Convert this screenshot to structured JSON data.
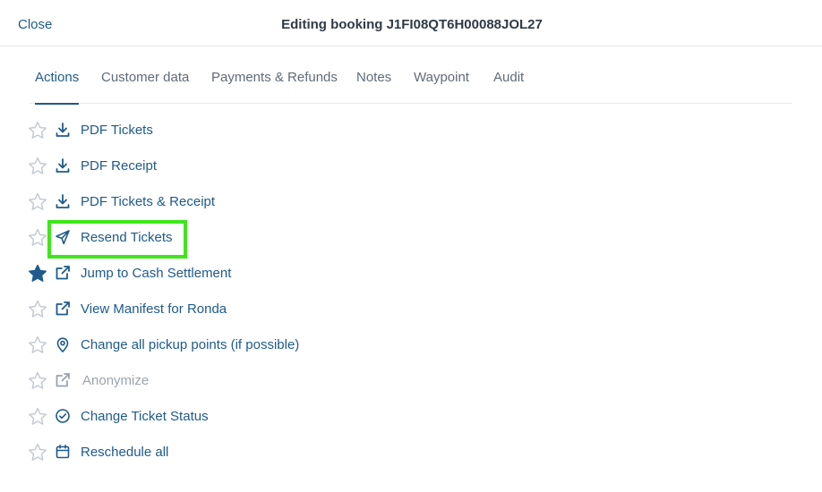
{
  "header": {
    "close_label": "Close",
    "title": "Editing booking J1FI08QT6H00088JOL27"
  },
  "tabs": [
    {
      "label": "Actions",
      "active": true
    },
    {
      "label": "Customer data",
      "active": false
    },
    {
      "label": "Payments & Refunds",
      "active": false
    },
    {
      "label": "Notes",
      "active": false
    },
    {
      "label": "Waypoint",
      "active": false
    },
    {
      "label": "Audit",
      "active": false
    }
  ],
  "actions": [
    {
      "label": "PDF Tickets",
      "icon": "download-icon",
      "starred": false,
      "enabled": true
    },
    {
      "label": "PDF Receipt",
      "icon": "download-icon",
      "starred": false,
      "enabled": true
    },
    {
      "label": "PDF Tickets & Receipt",
      "icon": "download-icon",
      "starred": false,
      "enabled": true
    },
    {
      "label": "Resend Tickets",
      "icon": "send-icon",
      "starred": false,
      "enabled": true
    },
    {
      "label": "Jump to Cash Settlement",
      "icon": "external-link-icon",
      "starred": true,
      "enabled": true
    },
    {
      "label": "View Manifest for Ronda",
      "icon": "external-link-icon",
      "starred": false,
      "enabled": true
    },
    {
      "label": "Change all pickup points (if possible)",
      "icon": "map-pin-icon",
      "starred": false,
      "enabled": true
    },
    {
      "label": "Anonymize",
      "icon": "external-link-icon",
      "starred": false,
      "enabled": false
    },
    {
      "label": "Change Ticket Status",
      "icon": "check-circle-icon",
      "starred": false,
      "enabled": true
    },
    {
      "label": "Reschedule all",
      "icon": "calendar-icon",
      "starred": false,
      "enabled": true
    }
  ],
  "colors": {
    "accent": "#1e5a8c",
    "highlight": "#3ee61a",
    "disabled": "#9aa3ad",
    "star_outline": "#c4cbd3"
  }
}
